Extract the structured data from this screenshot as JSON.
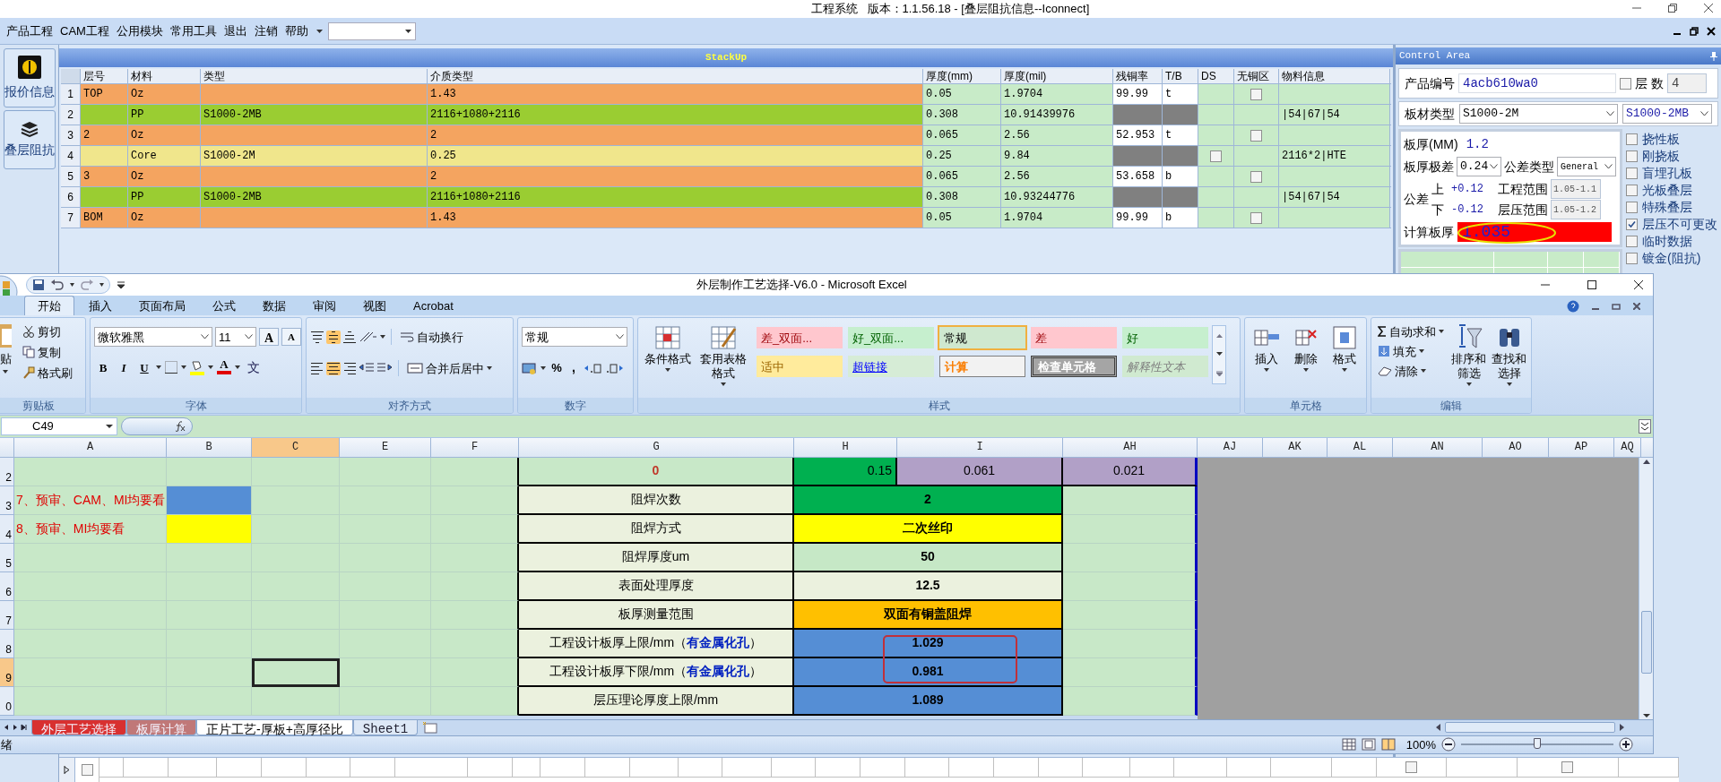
{
  "window": {
    "title": "工程系统   版本：1.1.56.18 - [叠层阻抗信息--Iconnect]"
  },
  "menu": [
    "产品工程",
    "CAM工程",
    "公用模块",
    "常用工具",
    "退出",
    "注销",
    "帮助"
  ],
  "sidebar": [
    {
      "label": "报价信息"
    },
    {
      "label": "叠层阻抗"
    }
  ],
  "stackup": {
    "title": "StackUp",
    "columns": [
      "层号",
      "材料",
      "类型",
      "介质类型",
      "厚度(mm)",
      "厚度(mil)",
      "残铜率",
      "T/B",
      "DS",
      "无铜区",
      "物料信息"
    ],
    "rows": [
      {
        "index": "1",
        "kind": "copper",
        "layer": "TOP",
        "material": "Oz",
        "dielectric": "1.43",
        "thk_mm": "0.05",
        "thk_mil": "1.9704",
        "copper_ratio": "99.99",
        "tb": "t",
        "no_copper_checked": false
      },
      {
        "index": "2",
        "kind": "prepreg",
        "material": "PP",
        "type": "S1000-2MB",
        "dielectric": "2116+1080+2116",
        "thk_mm": "0.308",
        "thk_mil": "10.91439976",
        "info": "|54|67|54"
      },
      {
        "index": "3",
        "kind": "copper",
        "layer": "2",
        "material": "Oz",
        "dielectric": "2",
        "thk_mm": "0.065",
        "thk_mil": "2.56",
        "copper_ratio": "52.953",
        "tb": "t",
        "no_copper_checked": false
      },
      {
        "index": "4",
        "kind": "core",
        "material": "Core",
        "type": "S1000-2M",
        "dielectric": "0.25",
        "thk_mm": "0.25",
        "thk_mil": "9.84",
        "ds_checked": false,
        "info": "2116*2|HTE"
      },
      {
        "index": "5",
        "kind": "copper",
        "layer": "3",
        "material": "Oz",
        "dielectric": "2",
        "thk_mm": "0.065",
        "thk_mil": "2.56",
        "copper_ratio": "53.658",
        "tb": "b",
        "no_copper_checked": false
      },
      {
        "index": "6",
        "kind": "prepreg",
        "material": "PP",
        "type": "S1000-2MB",
        "dielectric": "2116+1080+2116",
        "thk_mm": "0.308",
        "thk_mil": "10.93244776",
        "info": "|54|67|54"
      },
      {
        "index": "7",
        "kind": "copper",
        "layer": "BOM",
        "material": "Oz",
        "dielectric": "1.43",
        "thk_mm": "0.05",
        "thk_mil": "1.9704",
        "copper_ratio": "99.99",
        "tb": "b",
        "no_copper_checked": false
      }
    ]
  },
  "bottom_row": [
    {
      "checked": false
    },
    {
      "checked": false
    },
    {
      "checked": false
    }
  ],
  "control_area": {
    "title": "Control Area",
    "product_no": {
      "label": "产品编号",
      "value": "4acb610wa0"
    },
    "layer_count": {
      "label": "层 数",
      "checked": false,
      "value": "4"
    },
    "board_material": {
      "label": "板材类型",
      "values": [
        "S1000-2M",
        "S1000-2MB"
      ]
    },
    "thickness": {
      "label": "板厚(MM)",
      "value": "1.2"
    },
    "range": {
      "label": "板厚极差",
      "value": "0.24"
    },
    "tolerance_type": {
      "label": "公差类型",
      "value": "General"
    },
    "tolerance": {
      "label": "公差",
      "upper_label": "上",
      "upper": "+0.12",
      "lower_label": "下",
      "lower": "-0.12"
    },
    "eng_range": {
      "label": "工程范围",
      "value": "1.05-1.1"
    },
    "press_range": {
      "label": "层压范围",
      "value": "1.05-1.2"
    },
    "calc": {
      "label": "计算板厚",
      "value": "1.035"
    },
    "options": [
      {
        "label": "挠性板",
        "checked": false
      },
      {
        "label": "刚挠板",
        "checked": false
      },
      {
        "label": "盲埋孔板",
        "checked": false
      },
      {
        "label": "光板叠层",
        "checked": false
      },
      {
        "label": "特殊叠层",
        "checked": false
      },
      {
        "label": "层压不可更改",
        "checked": true
      },
      {
        "label": "临时数据",
        "checked": false
      },
      {
        "label": "镀金(阻抗)",
        "checked": false
      }
    ]
  },
  "excel": {
    "title": "外层制作工艺选择-V6.0 - Microsoft Excel",
    "tabs": [
      {
        "label": "开始",
        "selected": true
      },
      {
        "label": "插入",
        "selected": false
      },
      {
        "label": "页面布局",
        "selected": false
      },
      {
        "label": "公式",
        "selected": false
      },
      {
        "label": "数据",
        "selected": false
      },
      {
        "label": "审阅",
        "selected": false
      },
      {
        "label": "视图",
        "selected": false
      },
      {
        "label": "Acrobat",
        "selected": false
      }
    ],
    "ribbon": {
      "clipboard": {
        "label": "剪贴板",
        "paste": "贴",
        "cut": "剪切",
        "copy": "复制",
        "painter": "格式刷"
      },
      "font": {
        "label": "字体",
        "name": "微软雅黑",
        "size": "11",
        "grow": "A",
        "shrink": "A",
        "bold": "B",
        "italic": "I",
        "underline": "U",
        "color_label": "A",
        "phonetic": "文"
      },
      "alignment": {
        "label": "对齐方式",
        "wrap": "自动换行",
        "merge": "合并后居中"
      },
      "number": {
        "label": "数字",
        "format": "常规",
        "percent": "%",
        "comma": ","
      },
      "styles": {
        "label": "样式",
        "conditional": "条件格式",
        "table": "套用表格格式",
        "gallery": [
          {
            "label": "差_双面...",
            "kind": "bad",
            "selected": false
          },
          {
            "label": "好_双面...",
            "kind": "good",
            "selected": false
          },
          {
            "label": "常规",
            "kind": "normal",
            "selected": true
          },
          {
            "label": "差",
            "kind": "bad",
            "selected": false
          },
          {
            "label": "好",
            "kind": "good",
            "selected": false
          },
          {
            "label": "适中",
            "kind": "neutral",
            "selected": false
          },
          {
            "label": "超链接",
            "kind": "hyperlink",
            "selected": false
          },
          {
            "label": "计算",
            "kind": "calculation",
            "selected": false
          },
          {
            "label": "检查单元格",
            "kind": "check",
            "selected": false
          },
          {
            "label": "解释性文本",
            "kind": "explanatory",
            "selected": false
          }
        ]
      },
      "cells": {
        "label": "单元格",
        "insert": "插入",
        "delete": "删除",
        "format": "格式"
      },
      "editing": {
        "label": "编辑",
        "autosum": "自动求和",
        "fill": "填充",
        "clear": "清除",
        "sort": "排序和筛选",
        "find": "查找和选择"
      }
    },
    "name_box": "C49",
    "columns": [
      {
        "label": "A",
        "selected": false
      },
      {
        "label": "B",
        "selected": false
      },
      {
        "label": "C",
        "selected": true
      },
      {
        "label": "E",
        "selected": false
      },
      {
        "label": "F",
        "selected": false
      },
      {
        "label": "G",
        "selected": false
      },
      {
        "label": "H",
        "selected": false
      },
      {
        "label": "I",
        "selected": false
      },
      {
        "label": "AH",
        "selected": false
      },
      {
        "label": "AJ",
        "selected": false
      },
      {
        "label": "AK",
        "selected": false
      },
      {
        "label": "AL",
        "selected": false
      },
      {
        "label": "AN",
        "selected": false
      },
      {
        "label": "AO",
        "selected": false
      },
      {
        "label": "AP",
        "selected": false
      },
      {
        "label": "AQ",
        "selected": false
      }
    ],
    "rows": [
      {
        "header": "2",
        "selected": false,
        "kind": "values",
        "label": "0",
        "h": {
          "text": "0.15",
          "color": "#00b050"
        },
        "i": {
          "text": "0.061",
          "color": "#b1a0c7"
        },
        "ah": {
          "text": "0.021",
          "color": "#b1a0c7"
        }
      },
      {
        "header": "3",
        "selected": false,
        "kind": "item",
        "note": "7、预审、CAM、MI均要看",
        "color": "#558ed5",
        "label": "阻焊次数",
        "value": {
          "text": "2",
          "color": "#00b050"
        }
      },
      {
        "header": "4",
        "selected": false,
        "kind": "item",
        "note": "8、预审、MI均要看",
        "color": "#ffff00",
        "label": "阻焊方式",
        "value": {
          "text": "二次丝印",
          "color": "#ffff00"
        }
      },
      {
        "header": "5",
        "selected": false,
        "kind": "item",
        "label": "阻焊厚度um",
        "value": {
          "text": "50",
          "color": "#c6e8c6"
        }
      },
      {
        "header": "6",
        "selected": false,
        "kind": "item",
        "label": "表面处理厚度",
        "value": {
          "text": "12.5",
          "color": "#ebf1de"
        }
      },
      {
        "header": "7",
        "selected": false,
        "kind": "item",
        "label": "板厚测量范围",
        "value": {
          "text": "双面有铜盖阻焊",
          "color": "#ffc000"
        }
      },
      {
        "header": "8",
        "selected": false,
        "kind": "item",
        "label": "工程设计板厚上限/mm（**有金属化孔**）",
        "value": {
          "text": "1.029",
          "color": "#558ed5"
        }
      },
      {
        "header": "9",
        "selected": true,
        "kind": "item",
        "label": "工程设计板厚下限/mm（**有金属化孔**）",
        "value": {
          "text": "0.981",
          "color": "#558ed5"
        }
      },
      {
        "header": "0",
        "selected": false,
        "kind": "item",
        "label": "层压理论厚度上限/mm",
        "value": {
          "text": "1.089",
          "color": "#558ed5"
        }
      }
    ],
    "sheets": [
      {
        "label": "外层工艺选择",
        "selected": false,
        "color": "#d83030"
      },
      {
        "label": "板厚计算",
        "selected": false,
        "color": "#c07878"
      },
      {
        "label": "正片工艺-厚板+高厚径比",
        "selected": true
      },
      {
        "label": "Sheet1",
        "selected": false
      }
    ],
    "status": "绪",
    "zoom": {
      "label": "100%",
      "level": 0.5
    }
  }
}
